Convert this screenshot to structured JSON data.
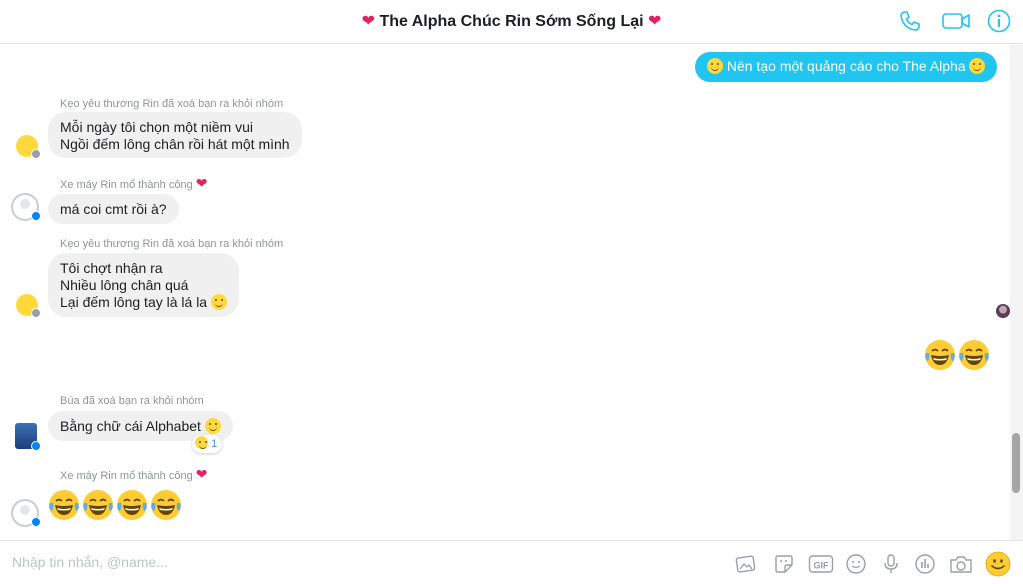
{
  "header": {
    "title": "The Alpha Chúc Rin Sớm Sống Lại",
    "heart": "❤",
    "icons": [
      "phone-icon",
      "video-icon",
      "info-icon"
    ],
    "accent": "#20c5f0"
  },
  "messages": {
    "out1": {
      "before": "🙂",
      "text": "Nên tạo một quảng cáo cho The Alpha"
    },
    "meta1": "Kẹo yêu thương Rin đã xoá bạn ra khỏi nhóm",
    "msg1": {
      "line1": "Mỗi ngày tôi chọn một niềm vui",
      "line2": "Ngồi đếm lông chân rồi hát một mình"
    },
    "meta2": "Xe máy Rin mổ thành công",
    "msg2": "má coi cmt rồi à?",
    "meta3": "Kẹo yêu thương Rin đã xoá bạn ra khỏi nhóm",
    "msg3": {
      "line1": "Tôi chợt nhận ra",
      "line2": "Nhiều lông chân quá",
      "line3": "Lại đếm lông tay là lá la"
    },
    "out2": "😂😂",
    "meta4": "Búa đã xoá bạn ra khỏi nhóm",
    "msg4": "Bằng chữ cái Alphabet",
    "msg4_reaction_count": "1",
    "meta5": "Xe máy Rin mổ thành công",
    "msg5": "😂😂😂😂"
  },
  "composer": {
    "placeholder": "Nhập tin nhắn, @name...",
    "tools": [
      "image-icon",
      "sticker-icon",
      "gif-icon",
      "emoji-icon",
      "microphone-icon",
      "poll-icon",
      "camera-icon",
      "like-emoji-icon"
    ]
  },
  "colors": {
    "outgoing_bubble": "#20c5f0",
    "incoming_bubble": "#f1f0f0",
    "heart": "#e0245e"
  }
}
